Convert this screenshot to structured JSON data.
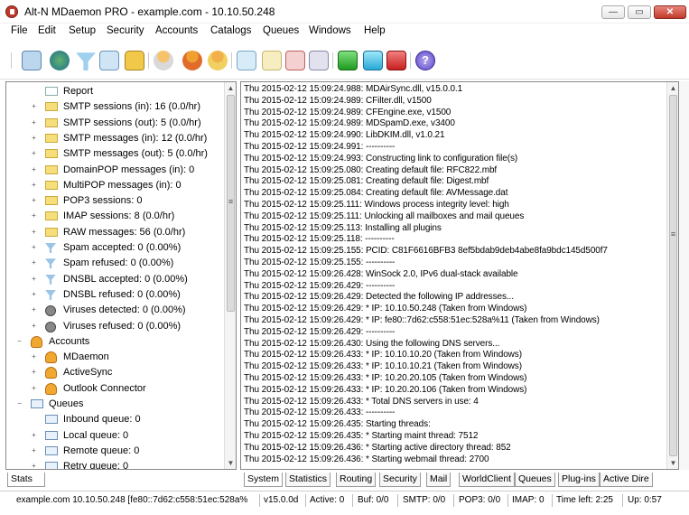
{
  "window": {
    "title": "Alt-N MDaemon PRO - example.com - 10.10.50.248",
    "minimize_glyph": "—",
    "restore_glyph": "▭",
    "close_glyph": "✕"
  },
  "menu": [
    "File",
    "Edit",
    "Setup",
    "Security",
    "Accounts",
    "Catalogs",
    "Queues",
    "Windows",
    "Help"
  ],
  "toolbar_icons": [
    "monitor-icon",
    "globe-icon",
    "funnel-icon",
    "address-book-icon",
    "lock-icon",
    "user-icon",
    "users-icon",
    "group-icon",
    "envelope-in-icon",
    "envelope-icon",
    "envelope-out-icon",
    "envelope-cycle-icon",
    "green-light-icon",
    "cyan-light-icon",
    "red-light-icon",
    "help-icon"
  ],
  "tree": [
    {
      "label": "Report",
      "icon": "doc",
      "exp": ""
    },
    {
      "label": "SMTP sessions (in): 16  (0.0/hr)",
      "icon": "folder",
      "exp": "+"
    },
    {
      "label": "SMTP sessions (out): 5  (0.0/hr)",
      "icon": "folder",
      "exp": "+"
    },
    {
      "label": "SMTP messages (in): 12  (0.0/hr)",
      "icon": "folder",
      "exp": "+"
    },
    {
      "label": "SMTP messages (out): 5  (0.0/hr)",
      "icon": "folder",
      "exp": "+"
    },
    {
      "label": "DomainPOP messages (in): 0",
      "icon": "folder",
      "exp": "+"
    },
    {
      "label": "MultiPOP messages (in): 0",
      "icon": "folder",
      "exp": "+"
    },
    {
      "label": "POP3 sessions: 0",
      "icon": "folder",
      "exp": "+"
    },
    {
      "label": "IMAP sessions: 8  (0.0/hr)",
      "icon": "folder",
      "exp": "+"
    },
    {
      "label": "RAW messages: 56  (0.0/hr)",
      "icon": "folder",
      "exp": "+"
    },
    {
      "label": "Spam accepted: 0  (0.00%)",
      "icon": "funnel",
      "exp": "+"
    },
    {
      "label": "Spam refused: 0  (0.00%)",
      "icon": "funnel",
      "exp": "+"
    },
    {
      "label": "DNSBL accepted: 0  (0.00%)",
      "icon": "funnel",
      "exp": "+"
    },
    {
      "label": "DNSBL refused: 0  (0.00%)",
      "icon": "funnel",
      "exp": "+"
    },
    {
      "label": "Viruses detected: 0  (0.00%)",
      "icon": "bug",
      "exp": "+"
    },
    {
      "label": "Viruses refused: 0  (0.00%)",
      "icon": "bug",
      "exp": "+"
    },
    {
      "label": "Accounts",
      "icon": "user",
      "exp": "−",
      "top": true
    },
    {
      "label": "MDaemon",
      "icon": "user",
      "exp": "+"
    },
    {
      "label": "ActiveSync",
      "icon": "user",
      "exp": "+"
    },
    {
      "label": "Outlook Connector",
      "icon": "user",
      "exp": "+"
    },
    {
      "label": "Queues",
      "icon": "mail",
      "exp": "−",
      "top": true
    },
    {
      "label": "Inbound queue: 0",
      "icon": "mail",
      "exp": ""
    },
    {
      "label": "Local queue: 0",
      "icon": "mail",
      "exp": "+"
    },
    {
      "label": "Remote queue: 0",
      "icon": "mail",
      "exp": "+"
    },
    {
      "label": "Retry queue: 0",
      "icon": "mail",
      "exp": "+"
    }
  ],
  "log_lines": [
    "Thu 2015-02-12 15:09:24.988: MDAirSync.dll, v15.0.0.1",
    "Thu 2015-02-12 15:09:24.989: CFilter.dll, v1500",
    "Thu 2015-02-12 15:09:24.989: CFEngine.exe, v1500",
    "Thu 2015-02-12 15:09:24.989: MDSpamD.exe, v3400",
    "Thu 2015-02-12 15:09:24.990: LibDKIM.dll, v1.0.21",
    "Thu 2015-02-12 15:09:24.991: ----------",
    "Thu 2015-02-12 15:09:24.993: Constructing link to configuration file(s)",
    "Thu 2015-02-12 15:09:25.080: Creating default file: RFC822.mbf",
    "Thu 2015-02-12 15:09:25.081: Creating default file: Digest.mbf",
    "Thu 2015-02-12 15:09:25.084: Creating default file: AVMessage.dat",
    "Thu 2015-02-12 15:09:25.111: Windows process integrity level: high",
    "Thu 2015-02-12 15:09:25.111: Unlocking all mailboxes and mail queues",
    "Thu 2015-02-12 15:09:25.113: Installing all plugins",
    "Thu 2015-02-12 15:09:25.118: ----------",
    "Thu 2015-02-12 15:09:25.155: PCID: C81F6616BFB3 8ef5bdab9deb4abe8fa9bdc145d500f7",
    "Thu 2015-02-12 15:09:25.155: ----------",
    "Thu 2015-02-12 15:09:26.428: WinSock 2.0, IPv6 dual-stack available",
    "Thu 2015-02-12 15:09:26.429: ----------",
    "Thu 2015-02-12 15:09:26.429: Detected the following IP addresses...",
    "Thu 2015-02-12 15:09:26.429: *  IP:  10.10.50.248  (Taken from Windows)",
    "Thu 2015-02-12 15:09:26.429: *  IP:  fe80::7d62:c558:51ec:528a%11  (Taken from Windows)",
    "Thu 2015-02-12 15:09:26.429: ----------",
    "Thu 2015-02-12 15:09:26.430: Using the following DNS servers...",
    "Thu 2015-02-12 15:09:26.433: *  IP:  10.10.10.20  (Taken from Windows)",
    "Thu 2015-02-12 15:09:26.433: *  IP:  10.10.10.21  (Taken from Windows)",
    "Thu 2015-02-12 15:09:26.433: *  IP:  10.20.20.105  (Taken from Windows)",
    "Thu 2015-02-12 15:09:26.433: *  IP:  10.20.20.106  (Taken from Windows)",
    "Thu 2015-02-12 15:09:26.433: *  Total DNS servers in use: 4",
    "Thu 2015-02-12 15:09:26.433: ----------",
    "Thu 2015-02-12 15:09:26.435: Starting threads:",
    "Thu 2015-02-12 15:09:26.435: *  Starting maint thread: 7512",
    "Thu 2015-02-12 15:09:26.436: *  Starting active directory thread: 852",
    "Thu 2015-02-12 15:09:26.436: *  Starting webmail thread: 2700"
  ],
  "left_tabs": [
    "Stats"
  ],
  "right_tabs": [
    "System",
    "Statistics",
    "Routing",
    "Security",
    "Mail",
    "WorldClient",
    "Queues",
    "Plug-ins",
    "Active Dire"
  ],
  "active_right_tab": "System",
  "status": [
    "example.com  10.10.50.248  [fe80::7d62:c558:51ec:528a%",
    "v15.0.0d",
    "Active: 0",
    "Buf: 0/0",
    "SMTP: 0/0",
    "POP3: 0/0",
    "IMAP: 0",
    "Time left: 2:25",
    "Up: 0:57"
  ],
  "scroll_glyphs": {
    "up": "▲",
    "down": "▼",
    "grip": "≡"
  },
  "status_label": "Stats"
}
